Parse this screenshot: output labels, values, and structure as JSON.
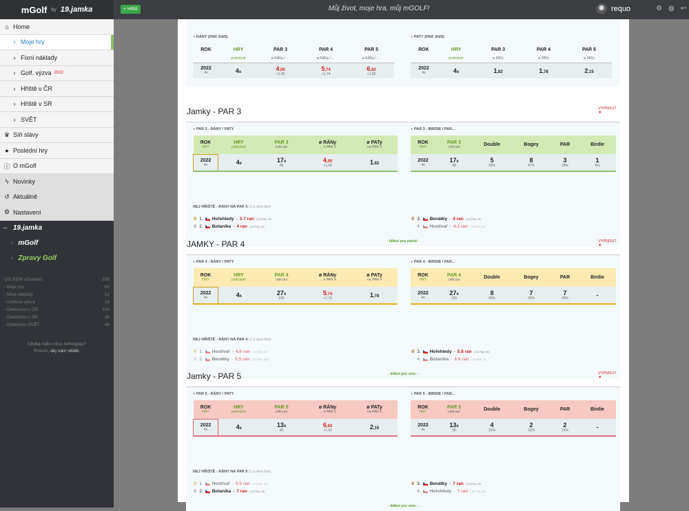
{
  "top": {
    "logo": "mGolf",
    "by": "by",
    "logo2": "19.jamka",
    "add": "+ HRA",
    "motto": "Můj život, moje hra, můj mGOLF!",
    "user": "requo"
  },
  "nav": {
    "items": [
      {
        "label": "Home",
        "icon": "home-icon"
      },
      {
        "label": "Moje hry",
        "sub": true,
        "active": true
      },
      {
        "label": "Fixní náklady",
        "sub": true
      },
      {
        "label": "Golf. výzva",
        "sub": true,
        "sup": "2022"
      },
      {
        "label": "Hřiště v ČR",
        "sub": true
      },
      {
        "label": "Hřiště v SR",
        "sub": true
      },
      {
        "label": "SVĚT",
        "sub": true
      },
      {
        "label": "Síň slávy",
        "icon": "trophy-icon"
      },
      {
        "label": "Poslední hry",
        "icon": "flag-icon"
      },
      {
        "label": "O mGolf",
        "icon": "info-icon"
      },
      {
        "label": "Novinky",
        "icon": "bolt-icon",
        "gray": true
      },
      {
        "label": "Aktuálně",
        "icon": "history-icon",
        "gray": true
      },
      {
        "label": "Nastavení",
        "icon": "gear-icon",
        "gray": true
      }
    ],
    "dark": {
      "logo1": "19.jamka",
      "logo2": "mGolf",
      "logo3": "Zpravy Golf"
    },
    "stats": [
      [
        "CELKEM uživatelů:",
        "258"
      ],
      [
        "- Moje hry",
        "60"
      ],
      [
        "- Mise náklady",
        "12"
      ],
      [
        "- Golfová výzva",
        "16"
      ],
      [
        "- Odehráno v ČR",
        "134"
      ],
      [
        "- Odehráno v SR",
        "48"
      ],
      [
        "- Odehráno SVĚT",
        "46"
      ]
    ],
    "help1": "Chyba nebo něco nefunguje?",
    "help2": "Prosím,",
    "help_link": "dej nám vědět."
  },
  "top_section": {
    "ph_left": "RÁNY (PAR 3/4/5)",
    "ph_right": "PATY (PAR 3/4/5)",
    "left_head": [
      "ROK",
      "HRY",
      "PAR 3",
      "PAR 4",
      "PAR 5"
    ],
    "left_sub": [
      "",
      "podrobně",
      "ø RÁNy / ←",
      "ø RÁNy / ←",
      "ø RÁNy / ←"
    ],
    "left_row": {
      "rok": "2022",
      "rs": "4x",
      "hry": "4",
      "hs": "x",
      "p3": "4",
      "p3d": ",00",
      "p3s": "+1,00",
      "p4": "5",
      "p4d": ",74",
      "p4s": "+1,74",
      "p5": "6",
      "p5d": ",92",
      "p5s": "+1,92"
    },
    "right_head": [
      "ROK",
      "HRY",
      "PAR 3",
      "PAR 4",
      "PAR 5"
    ],
    "right_sub": [
      "",
      "podrobně",
      "ø PATy",
      "ø PATy",
      "ø PATy"
    ],
    "right_row": {
      "rok": "2022",
      "rs": "4x",
      "hry": "4",
      "hs": "x",
      "p3": "1",
      "p3d": ",82",
      "p4": "1",
      "p4d": ",78",
      "p5": "2",
      "p5d": ",15"
    }
  },
  "sections": [
    {
      "title": "Jamky - PAR 3",
      "toggle": "VYPNOUT",
      "ph_left": "PAR 3 - RÁNY / PATY",
      "ph_right": "PAR 3 - BIRDIE / PAR...",
      "lh": [
        "ROK",
        "HRY",
        "PAR 3",
        "ø RÁNy",
        "ø PATy"
      ],
      "ls": [
        "HRY",
        "podrobně",
        "celk.ran",
        "← k PAR 3",
        "na PAR 3"
      ],
      "lr": {
        "rok": "2022",
        "rs": "4x",
        "hry": "4",
        "hs": "x",
        "c": "17",
        "cx": "x",
        "cs": "68",
        "r": "4",
        "rd": ",00",
        "rs2": "+1,00",
        "p": "1",
        "pd": ",82"
      },
      "rh": [
        "ROK",
        "PAR 3",
        "Double",
        "Bogey",
        "PAR",
        "Birdie"
      ],
      "rsub": [
        "HRY",
        "celk.ran"
      ],
      "rr": {
        "rok": "2022",
        "rs": "4x",
        "c": "17",
        "cx": "x",
        "cs": "68",
        "d": "5",
        "dp": "29%",
        "b": "8",
        "bp": "47%",
        "p": "3",
        "pp": "18%",
        "bi": "1",
        "bip": "6%"
      },
      "nej": "NEJ HŘIŠTĚ - RÁNY NA PAR 3",
      "nej_note": "(1 a více her)",
      "nl": [
        {
          "n": "1.",
          "name": "Hořehledy",
          "val": "3.7 ran",
          "note": "| 1x hra, 3x",
          "tr": "gold",
          "faded": false
        },
        {
          "n": "2.",
          "name": "Botanika",
          "val": "4 ran",
          "note": "| 1x hra, 6x",
          "tr": "silver",
          "faded": false
        }
      ],
      "nr": [
        {
          "n": "3.",
          "name": "Benátky",
          "val": "4 ran",
          "note": "| 1x hra, 4x",
          "tr": "bronze",
          "faded": false
        },
        {
          "n": "4.",
          "name": "Hostivař",
          "val": "4.3 ran",
          "note": "| 1x hra, 4x",
          "tr": "",
          "faded": true
        }
      ],
      "more": "- klikni pro méně -"
    },
    {
      "title": "JAMKY - PAR 4",
      "toggle": "VYPNOUT",
      "ph_left": "PAR 4 - RÁNY / PATY",
      "ph_right": "PAR 4 - BIRDIE / PAR...",
      "lh": [
        "ROK",
        "HRY",
        "PAR 4",
        "ø RÁNy",
        "ø PATy"
      ],
      "ls": [
        "HRY",
        "podrobně",
        "celk.ran",
        "← k PAR 4",
        "na PAR 4"
      ],
      "lr": {
        "rok": "2022",
        "rs": "4x",
        "hry": "4",
        "hs": "x",
        "c": "27",
        "cx": "x",
        "cs": "155",
        "r": "5",
        "rd": ",74",
        "rs2": "+1,74",
        "p": "1",
        "pd": ",78"
      },
      "rh": [
        "ROK",
        "PAR 4",
        "Double",
        "Bogey",
        "PAR",
        "Birdie"
      ],
      "rsub": [
        "HRY",
        "celk.ran"
      ],
      "rr": {
        "rok": "2022",
        "rs": "4x",
        "c": "27",
        "cx": "x",
        "cs": "155",
        "d": "8",
        "dp": "30%",
        "b": "7",
        "bp": "26%",
        "p": "7",
        "pp": "26%",
        "bi": "-",
        "bip": ""
      },
      "nej": "NEJ HŘIŠTĚ - RÁNY NA PAR 4",
      "nej_note": "(1 a více her)",
      "nl": [
        {
          "n": "1.",
          "name": "Hostivař",
          "val": "4.8 ran",
          "note": "| 1x hra, 5x",
          "tr": "gold",
          "faded": true
        },
        {
          "n": "2.",
          "name": "Benátky",
          "val": "5.5 ran",
          "note": "| 1x hra, 10x",
          "tr": "silver",
          "faded": true
        }
      ],
      "nr": [
        {
          "n": "3.",
          "name": "Hořehledy",
          "val": "5.8 ran",
          "note": "| 1x hra, 5x",
          "tr": "bronze",
          "faded": false
        },
        {
          "n": "4.",
          "name": "Botanika",
          "val": "6.9 ran",
          "note": "| 1x hra, 7x",
          "tr": "",
          "faded": true
        }
      ],
      "more": "- klikni pro více -"
    },
    {
      "title": "Jamky - PAR 5",
      "toggle": "VYPNOUT",
      "ph_left": "PAR 5 - RÁNY / PATY",
      "ph_right": "PAR 5 - BIRDIE / PAR...",
      "lh": [
        "ROK",
        "HRY",
        "PAR 5",
        "ø RÁNy",
        "ø PATy"
      ],
      "ls": [
        "HRY",
        "podrobně",
        "celk.ran",
        "← k PAR 5",
        "na PAR 5"
      ],
      "lr": {
        "rok": "2022",
        "rs": "4x",
        "hry": "4",
        "hs": "x",
        "c": "13",
        "cx": "x",
        "cs": "90",
        "r": "6",
        "rd": ",92",
        "rs2": "+1,92",
        "p": "2",
        "pd": ",15"
      },
      "rh": [
        "ROK",
        "PAR 5",
        "Double",
        "Bogey",
        "PAR",
        "Birdie"
      ],
      "rsub": [
        "HRY",
        "celk.ran"
      ],
      "rr": {
        "rok": "2022",
        "rs": "4x",
        "c": "13",
        "cx": "x",
        "cs": "90",
        "d": "4",
        "dp": "31%",
        "b": "2",
        "bp": "15%",
        "p": "2",
        "pp": "15%",
        "bi": "-",
        "bip": ""
      },
      "nej": "NEJ HŘIŠTĚ - RÁNY NA PAR 5",
      "nej_note": "(1 a více her)",
      "nl": [
        {
          "n": "1.",
          "name": "Hostivař",
          "val": "5.5 ran",
          "note": "| 1x hra, 2x",
          "tr": "gold",
          "faded": true
        },
        {
          "n": "2.",
          "name": "Botanika",
          "val": "7 ran",
          "note": "| 1x hra, 3x",
          "tr": "silver",
          "faded": false
        }
      ],
      "nr": [
        {
          "n": "3.",
          "name": "Benátky",
          "val": "7 ran",
          "note": "| 1x hra, 2x",
          "tr": "bronze",
          "faded": false
        },
        {
          "n": "4.",
          "name": "Hořehledy",
          "val": "7 ran",
          "note": "| 1x hra, 2x",
          "tr": "",
          "faded": true
        }
      ],
      "more": "- klikni pro více -"
    }
  ],
  "colors": {
    "par3": "#d3e9b4",
    "par4": "#fbeab2",
    "par5": "#f8c8c3",
    "accent": "#3aa64a"
  }
}
